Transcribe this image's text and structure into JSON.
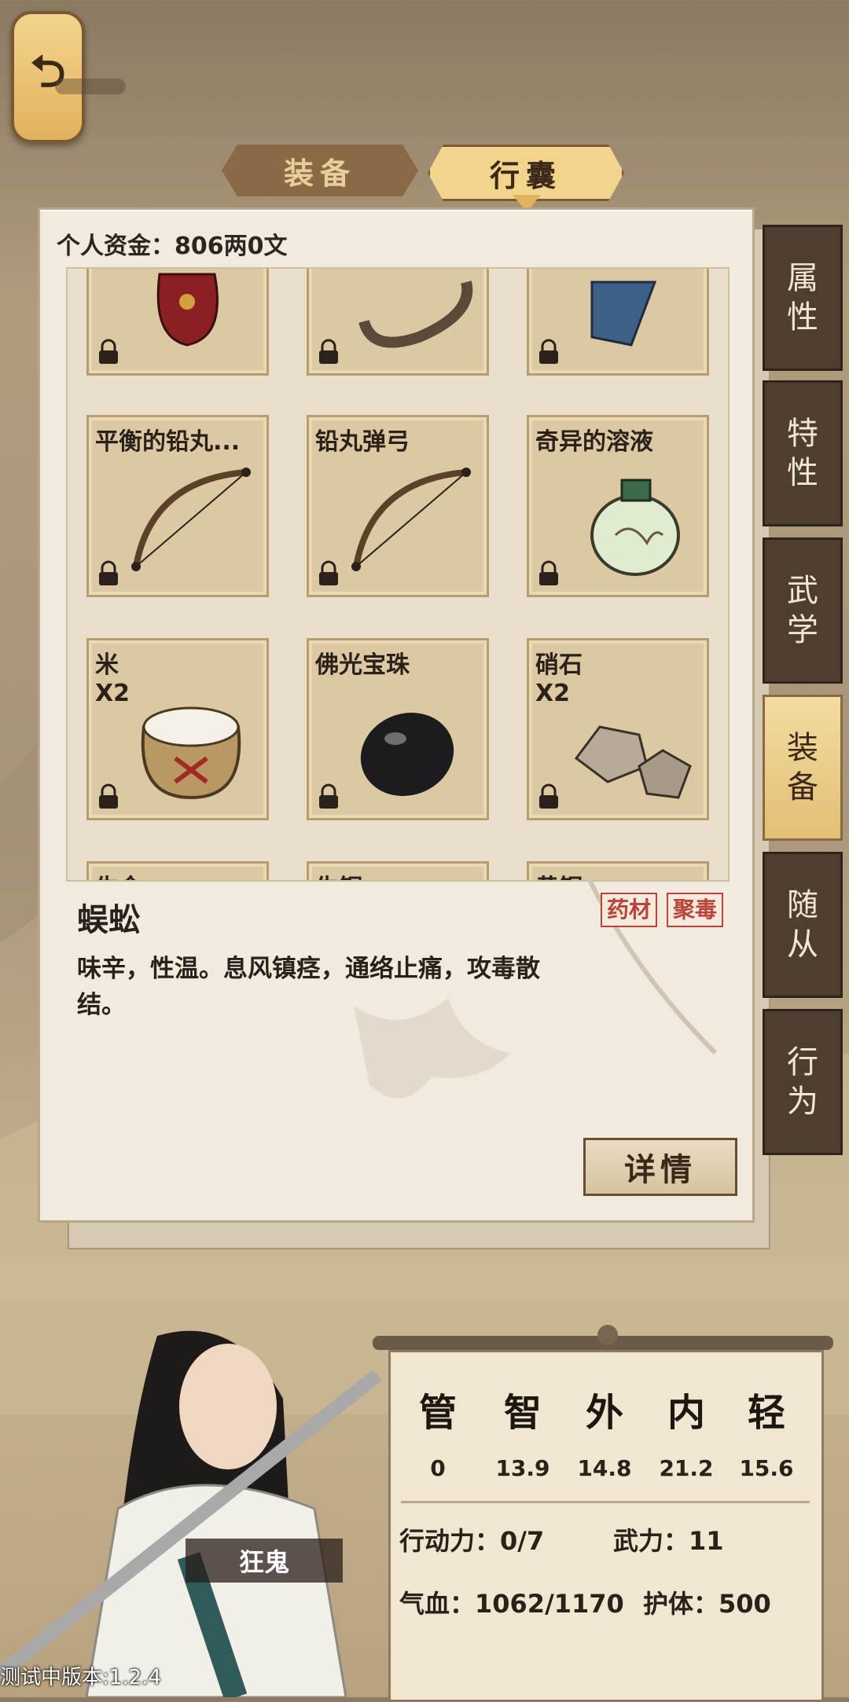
{
  "back": {
    "label": "⮌"
  },
  "tabs": [
    {
      "label": "装备",
      "active": false
    },
    {
      "label": "行囊",
      "active": true
    }
  ],
  "funds": "个人资金：806两0文",
  "inventory": {
    "items": [
      {
        "name": "",
        "qty": "",
        "icon": "red-pouch-icon"
      },
      {
        "name": "",
        "qty": "",
        "icon": "leather-strap-icon"
      },
      {
        "name": "",
        "qty": "",
        "icon": "blue-book-icon"
      },
      {
        "name": "平衡的铅丸...",
        "qty": "",
        "icon": "bow-icon"
      },
      {
        "name": "铅丸弹弓",
        "qty": "",
        "icon": "bow-icon"
      },
      {
        "name": "奇异的溶液",
        "qty": "",
        "icon": "potion-jar-icon"
      },
      {
        "name": "米",
        "qty": "X2",
        "icon": "rice-sack-icon"
      },
      {
        "name": "佛光宝珠",
        "qty": "",
        "icon": "black-gem-icon"
      },
      {
        "name": "硝石",
        "qty": "X2",
        "icon": "rock-icon"
      },
      {
        "name": "生金",
        "qty": "",
        "icon": ""
      },
      {
        "name": "生铜",
        "qty": "",
        "icon": ""
      },
      {
        "name": "黄铜",
        "qty": "",
        "icon": ""
      }
    ]
  },
  "detail": {
    "name": "蜈蚣",
    "tags": [
      "药材",
      "聚毒"
    ],
    "description": "味辛，性温。息风镇痉，通络止痛，攻毒散结。",
    "button": "详情"
  },
  "side_tabs": [
    {
      "label": "属\n性",
      "active": false
    },
    {
      "label": "特\n性",
      "active": false
    },
    {
      "label": "武\n学",
      "active": false
    },
    {
      "label": "装\n备",
      "active": true
    },
    {
      "label": "随\n从",
      "active": false
    },
    {
      "label": "行\n为",
      "active": false
    }
  ],
  "character": {
    "name": "狂鬼",
    "stats": [
      {
        "label": "管",
        "value": "0"
      },
      {
        "label": "智",
        "value": "13.9"
      },
      {
        "label": "外",
        "value": "14.8"
      },
      {
        "label": "内",
        "value": "21.2"
      },
      {
        "label": "轻",
        "value": "15.6"
      }
    ],
    "action_points": "行动力：0/7",
    "force": "武力：11",
    "hp": "气血：1062/1170",
    "armor": "护体：500"
  },
  "version": "测试中版本:1.2.4",
  "colors": {
    "accent": "#f3d48d",
    "dark_tab": "#4e3d31",
    "tag_red": "#b8443a"
  }
}
